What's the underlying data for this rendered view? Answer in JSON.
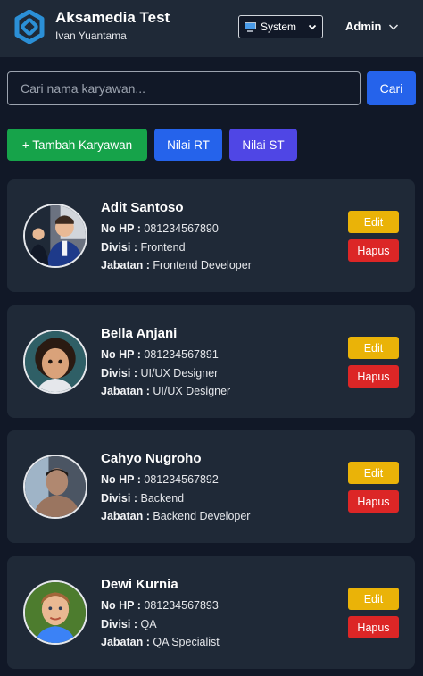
{
  "header": {
    "title": "Aksamedia Test",
    "subtitle": "Ivan Yuantama",
    "theme_value": "System",
    "user_menu": "Admin"
  },
  "search": {
    "placeholder": "Cari nama karyawan...",
    "value": "",
    "button": "Cari"
  },
  "actions": {
    "add": "+ Tambah Karyawan",
    "nilai_rt": "Nilai RT",
    "nilai_st": "Nilai ST"
  },
  "labels": {
    "phone": "No HP :",
    "division": "Divisi :",
    "position": "Jabatan :",
    "edit": "Edit",
    "delete": "Hapus"
  },
  "employees": [
    {
      "name": "Adit Santoso",
      "phone": "081234567890",
      "division": "Frontend",
      "position": "Frontend Developer"
    },
    {
      "name": "Bella Anjani",
      "phone": "081234567891",
      "division": "UI/UX Designer",
      "position": "UI/UX Designer"
    },
    {
      "name": "Cahyo Nugroho",
      "phone": "081234567892",
      "division": "Backend",
      "position": "Backend Developer"
    },
    {
      "name": "Dewi Kurnia",
      "phone": "081234567893",
      "division": "QA",
      "position": "QA Specialist"
    }
  ],
  "colors": {
    "background": "#111827",
    "surface": "#1f2937",
    "primary": "#2563eb",
    "success": "#16a34a",
    "indigo": "#4f46e5",
    "warning": "#eab308",
    "danger": "#dc2626",
    "logo": "#2b8fd6"
  }
}
